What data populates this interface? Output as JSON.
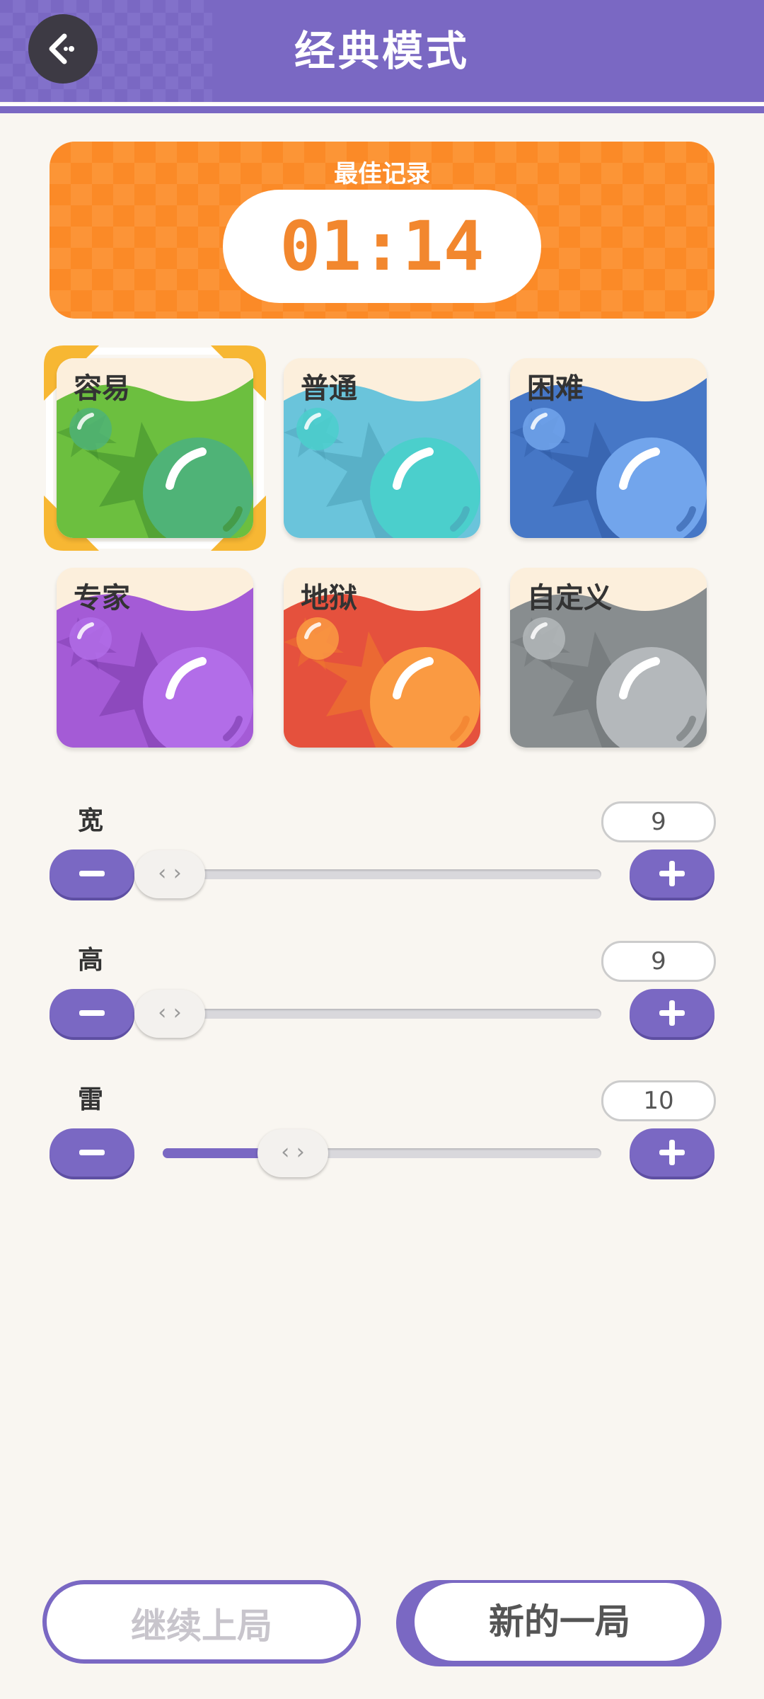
{
  "header": {
    "title": "经典模式"
  },
  "record": {
    "label": "最佳记录",
    "time": "01:14"
  },
  "modes": [
    {
      "label": "容易",
      "colors": {
        "bg": "#6cbf3f",
        "dark": "#3f8c2c",
        "orb": "#4fb377"
      },
      "selected": true
    },
    {
      "label": "普通",
      "colors": {
        "bg": "#6ac4db",
        "dark": "#4aa0b6",
        "orb": "#4bcfcc"
      },
      "selected": false
    },
    {
      "label": "困难",
      "colors": {
        "bg": "#4677c6",
        "dark": "#2f5aa3",
        "orb": "#72a5ec"
      },
      "selected": false
    },
    {
      "label": "专家",
      "colors": {
        "bg": "#a45bd6",
        "dark": "#7a3aaa",
        "orb": "#b26de8"
      },
      "selected": false
    },
    {
      "label": "地狱",
      "colors": {
        "bg": "#e5513d",
        "dark": "#f07d2c",
        "orb": "#fa9a42"
      },
      "selected": false
    },
    {
      "label": "自定义",
      "colors": {
        "bg": "#888d8f",
        "dark": "#6c7173",
        "orb": "#b4b8bb"
      },
      "selected": false
    }
  ],
  "sliders": [
    {
      "label": "宽",
      "value": "9",
      "thumb_glyph": "‹ ›",
      "fraction": 0.0
    },
    {
      "label": "高",
      "value": "9",
      "thumb_glyph": "‹ ›",
      "fraction": 0.0
    },
    {
      "label": "雷",
      "value": "10",
      "thumb_glyph": "‹ ›",
      "fraction": 0.28
    }
  ],
  "buttons": {
    "continue": "继续上局",
    "new_game": "新的一局"
  },
  "colors": {
    "accent": "#7a68c3",
    "record": "#fb8a27",
    "time_text": "#f2872e",
    "select_corner": "#f7b733"
  }
}
